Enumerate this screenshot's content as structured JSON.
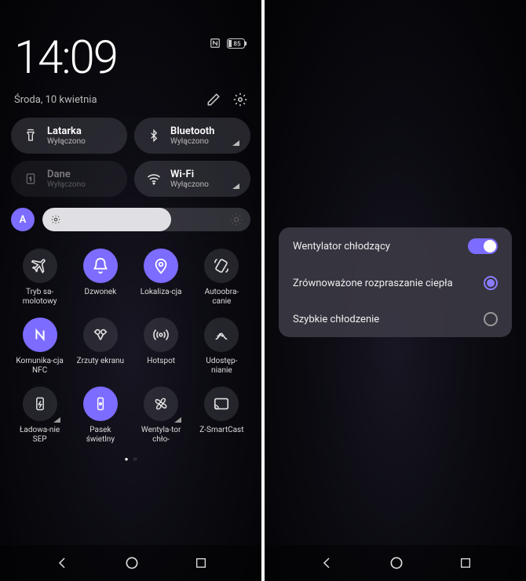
{
  "status": {
    "battery": "85"
  },
  "clock": "14:09",
  "date": "Środa, 10 kwietnia",
  "pills": [
    {
      "title": "Latarka",
      "sub": "Wyłączono"
    },
    {
      "title": "Bluetooth",
      "sub": "Wyłączono"
    },
    {
      "title": "Dane",
      "sub": "Wyłączono"
    },
    {
      "title": "Wi-Fi",
      "sub": "Wyłączono"
    }
  ],
  "auto_brightness_label": "A",
  "tiles": [
    {
      "label": "Tryb sa-molotowy",
      "active": false
    },
    {
      "label": "Dzwonek",
      "active": true
    },
    {
      "label": "Lokaliza-cja",
      "active": true
    },
    {
      "label": "Autoobra-canie",
      "active": false
    },
    {
      "label": "Komunika-cja NFC",
      "active": true
    },
    {
      "label": "Zrzuty ekranu",
      "active": false
    },
    {
      "label": "Hotspot",
      "active": false
    },
    {
      "label": "Udostęp-nianie",
      "active": false
    },
    {
      "label": "Ładowa-nie SEP",
      "active": false
    },
    {
      "label": "Pasek świetlny",
      "active": true
    },
    {
      "label": "Wentyla-tor chło-",
      "active": false
    },
    {
      "label": "Z-SmartCast",
      "active": false
    }
  ],
  "panel": {
    "title": "Wentylator chłodzący",
    "option1": "Zrównoważone rozpraszanie ciepła",
    "option2": "Szybkie chłodzenie"
  }
}
